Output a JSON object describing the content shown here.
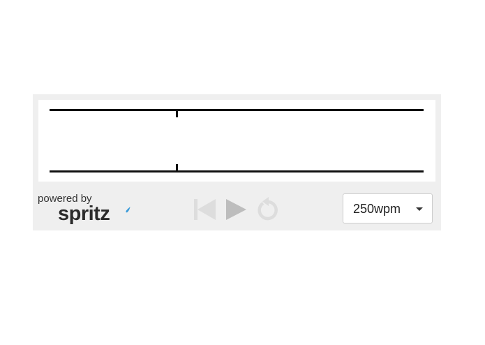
{
  "branding": {
    "powered_by": "powered by",
    "logo_text": "spritz",
    "accent_color": "#3a9bd9"
  },
  "reader": {
    "current_word": ""
  },
  "controls": {
    "back_icon": "skip-back-icon",
    "play_icon": "play-icon",
    "restart_icon": "restart-icon"
  },
  "speed": {
    "selected": "250wpm"
  },
  "colors": {
    "frame": "#efefef",
    "guide_lines": "#111111",
    "disabled_control": "#dddddd",
    "play_control": "#bdbdbd"
  }
}
